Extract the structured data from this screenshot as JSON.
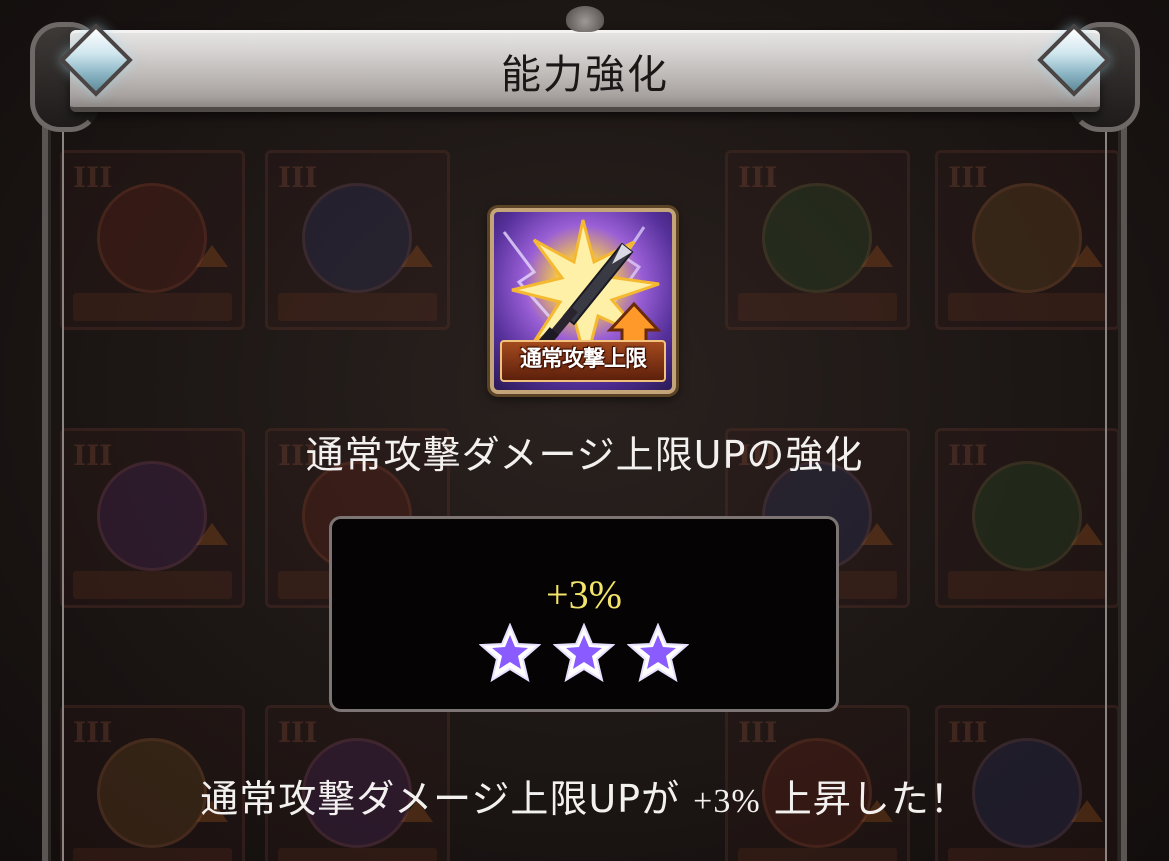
{
  "dialog": {
    "title": "能力強化"
  },
  "skill": {
    "icon_label": "通常攻撃上限",
    "name": "通常攻撃ダメージ上限UPの強化"
  },
  "enhancement": {
    "value": "+3%",
    "star_rating": 3,
    "star_max": 3
  },
  "result": {
    "prefix": "通常攻撃ダメージ上限UPが",
    "value": "+3%",
    "suffix": "上昇した！"
  },
  "icons": {
    "skill_icon": "sword-burst-up-arrow-icon",
    "star_icon": "purple-star-icon",
    "gem_icon": "diamond-gem-icon"
  },
  "colors": {
    "value_text": "#f4e46a",
    "star_fill": "#8a5cff",
    "text": "#f3f1ef"
  }
}
